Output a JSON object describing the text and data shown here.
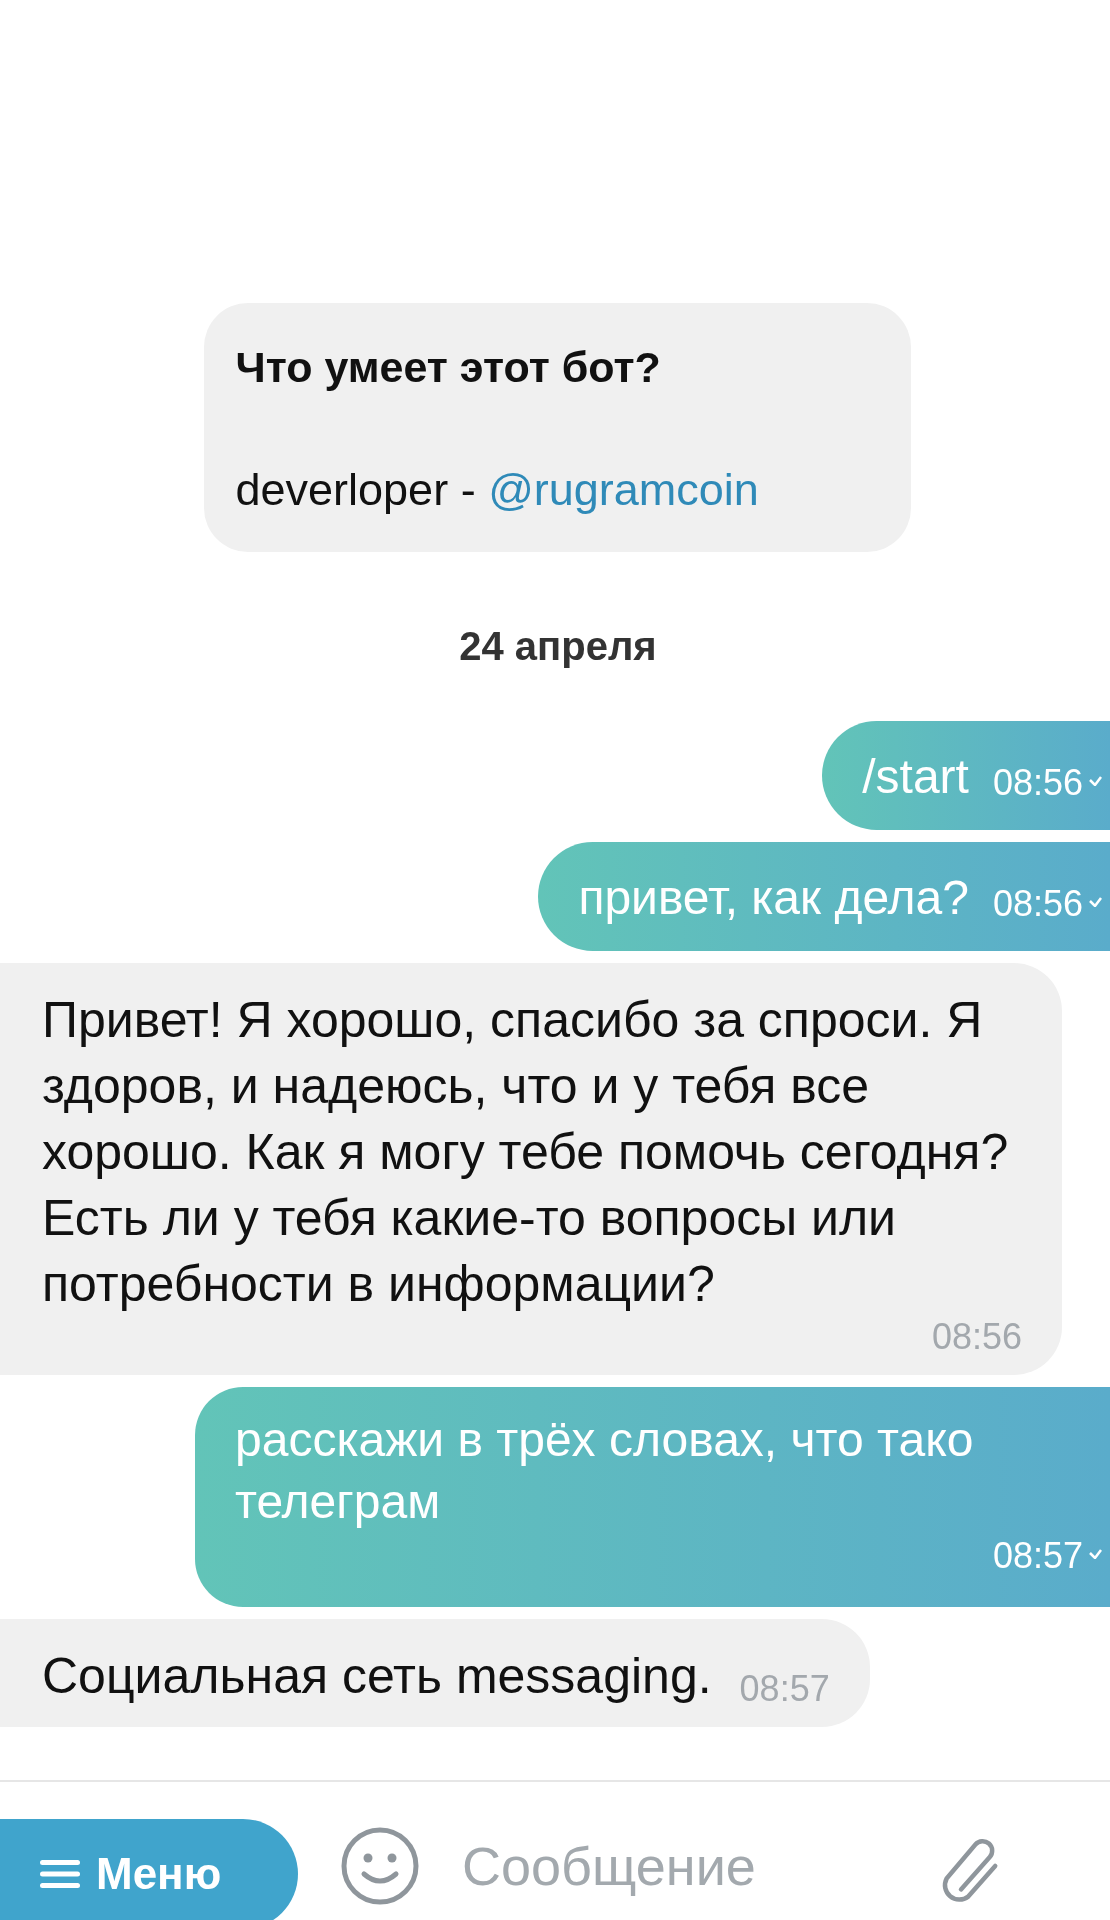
{
  "intro": {
    "title": "Что умеет этот бот?",
    "text": "deverloper - ",
    "link": "@rugramcoin"
  },
  "date": "24 апреля",
  "messages": [
    {
      "kind": "out",
      "text": "/start",
      "time": "08:56"
    },
    {
      "kind": "out",
      "text": "привет, как дела?",
      "time": "08:56"
    },
    {
      "kind": "in",
      "text": "Привет! Я хорошо, спасибо за спроси. Я здоров, и надеюсь, что и у тебя все хорошо. Как я могу тебе помочь сегодня? Есть ли у тебя какие-то вопросы или потребности в информации?",
      "time": "08:56"
    },
    {
      "kind": "out",
      "text": "расскажи в трёх словах, что тако\nтелеграм",
      "time": "08:57"
    },
    {
      "kind": "in",
      "text": "Социальная сеть messaging.",
      "time": "08:57"
    }
  ],
  "composer": {
    "menu": "Меню",
    "placeholder": "Сообщение"
  }
}
